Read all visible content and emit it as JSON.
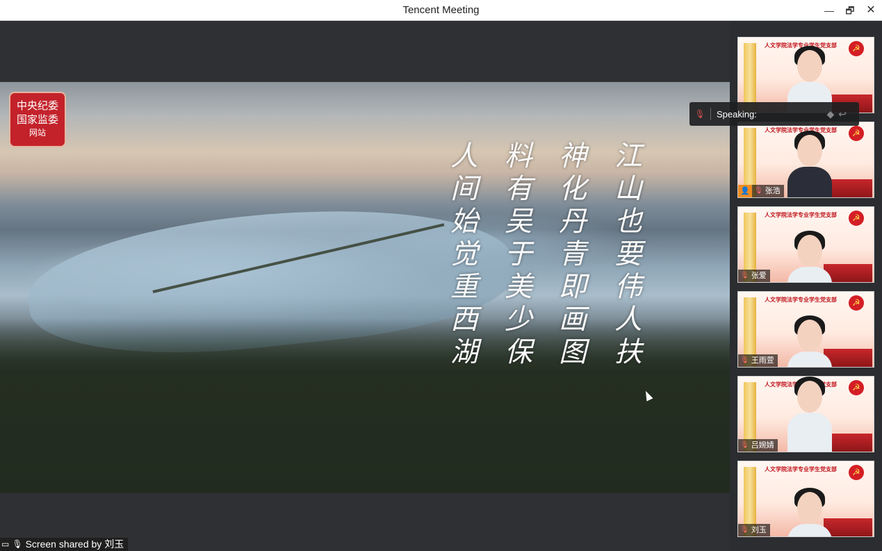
{
  "window": {
    "title": "Tencent Meeting",
    "minimize_icon": "—",
    "maximize_icon": "🗗",
    "close_icon": "✕"
  },
  "shared_screen": {
    "logo_line1": "中央纪委",
    "logo_line2": "国家监委",
    "logo_line3": "网站",
    "poem_columns": [
      "江山也要伟人扶",
      "神化丹青即画图",
      "料有吴于美少保",
      "人间始觉重西湖"
    ],
    "share_label": "Screen shared by 刘玉"
  },
  "speaking_bar": {
    "label": "Speaking:"
  },
  "participants": [
    {
      "name": "",
      "banner": "人文学院法学专业学生党支部"
    },
    {
      "name": "张浩",
      "banner": "人文学院法学专业学生党支部",
      "host": true
    },
    {
      "name": "张爱",
      "banner": "人文学院法学专业学生党支部"
    },
    {
      "name": "王雨萱",
      "banner": "人文学院法学专业学生党支部"
    },
    {
      "name": "吕婉婧",
      "banner": "人文学院法学专业学生党支部"
    },
    {
      "name": "刘玉",
      "banner": "人文学院法学专业学生党支部"
    }
  ]
}
